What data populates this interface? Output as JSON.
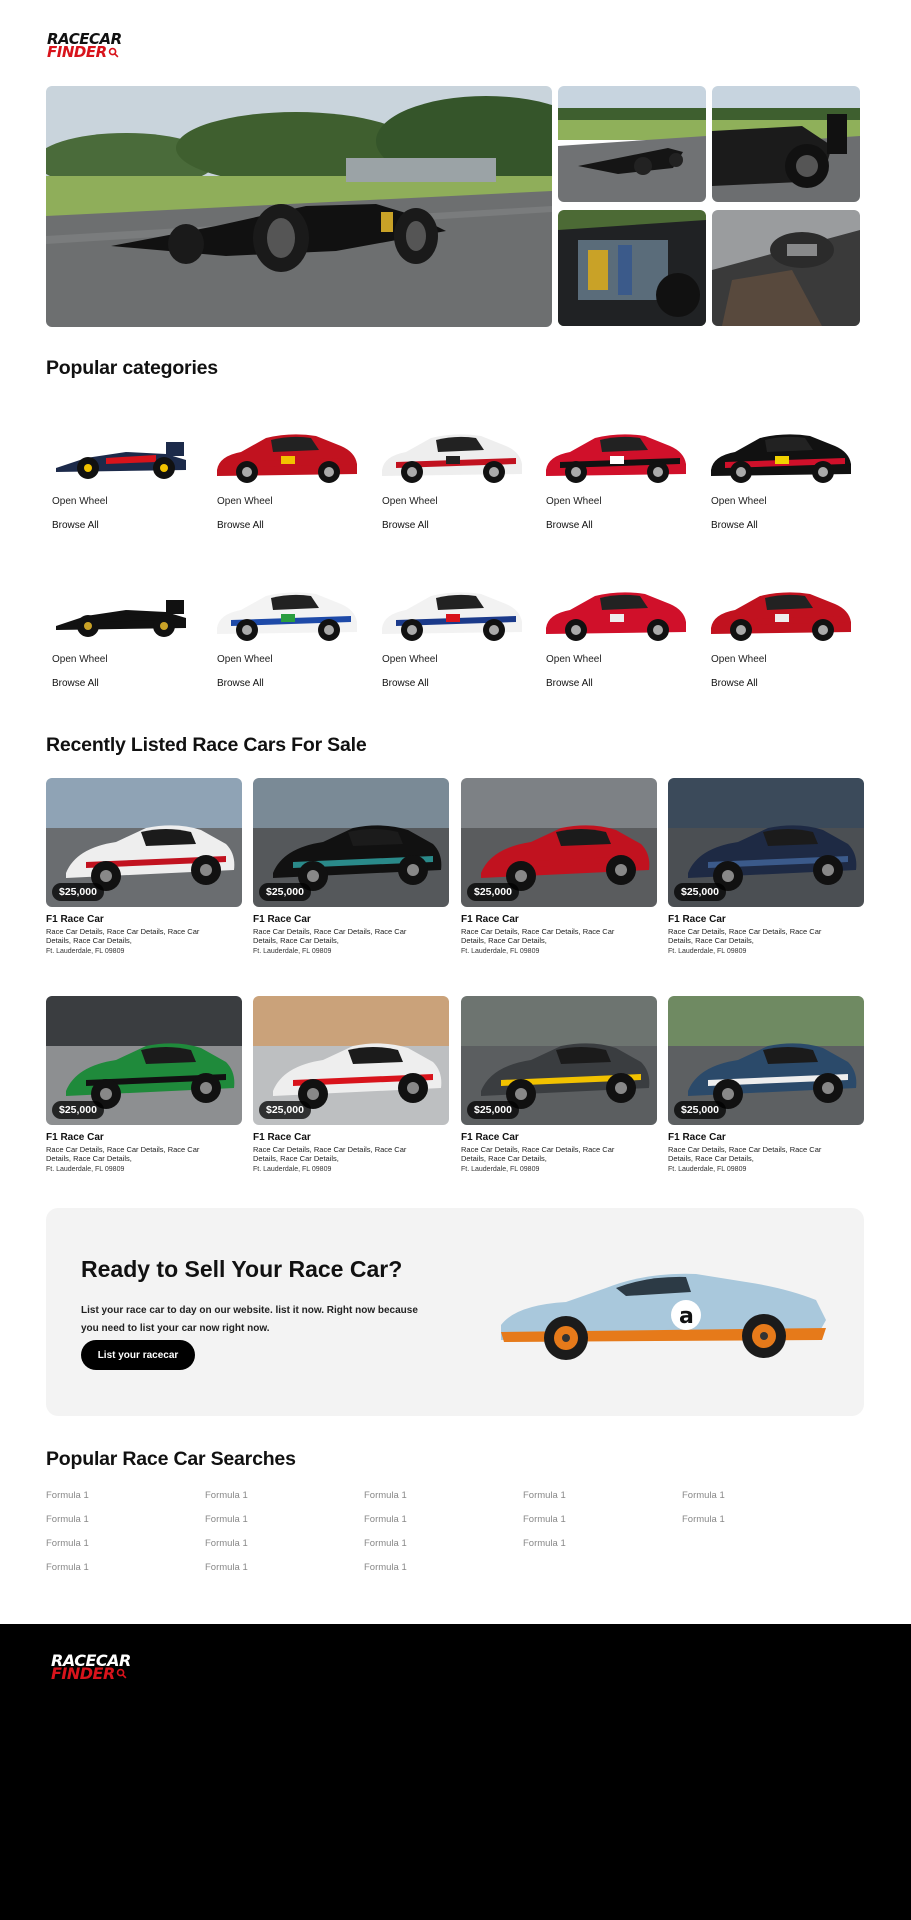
{
  "brand": {
    "line1": "RACECAR",
    "line2": "FINDER",
    "accent": "#d8131b"
  },
  "sections": {
    "categories_title": "Popular categories",
    "listings_title": "Recently Listed Race Cars For Sale",
    "searches_title": "Popular Race Car Searches"
  },
  "categories": [
    {
      "name": "Open Wheel",
      "browse": "Browse All",
      "icon": "f1-car-redbull"
    },
    {
      "name": "Open Wheel",
      "browse": "Browse All",
      "icon": "prototype-ferrari"
    },
    {
      "name": "Open Wheel",
      "browse": "Browse All",
      "icon": "gt-porsche-91"
    },
    {
      "name": "Open Wheel",
      "browse": "Browse All",
      "icon": "touring-car-red"
    },
    {
      "name": "Open Wheel",
      "browse": "Browse All",
      "icon": "nascar-24"
    },
    {
      "name": "Open Wheel",
      "browse": "Browse All",
      "icon": "vintage-f1-black"
    },
    {
      "name": "Open Wheel",
      "browse": "Browse All",
      "icon": "rally-car-blue"
    },
    {
      "name": "Open Wheel",
      "browse": "Browse All",
      "icon": "gt-worthouse"
    },
    {
      "name": "Open Wheel",
      "browse": "Browse All",
      "icon": "vintage-roadster-red"
    },
    {
      "name": "Open Wheel",
      "browse": "Browse All",
      "icon": "miata-roadster-red"
    }
  ],
  "listings": [
    {
      "price": "$25,000",
      "title": "F1 Race Car",
      "desc": "Race Car Details, Race Car Details, Race Car Details, Race Car Details,",
      "location": "Ft. Lauderdale, FL 09809"
    },
    {
      "price": "$25,000",
      "title": "F1 Race Car",
      "desc": "Race Car Details, Race Car Details, Race Car Details, Race Car Details,",
      "location": "Ft. Lauderdale, FL 09809"
    },
    {
      "price": "$25,000",
      "title": "F1 Race Car",
      "desc": "Race Car Details, Race Car Details, Race Car Details, Race Car Details,",
      "location": "Ft. Lauderdale, FL 09809"
    },
    {
      "price": "$25,000",
      "title": "F1 Race Car",
      "desc": "Race Car Details, Race Car Details, Race Car Details, Race Car Details,",
      "location": "Ft. Lauderdale, FL 09809"
    },
    {
      "price": "$25,000",
      "title": "F1 Race Car",
      "desc": "Race Car Details, Race Car Details, Race Car Details, Race Car Details,",
      "location": "Ft. Lauderdale, FL 09809"
    },
    {
      "price": "$25,000",
      "title": "F1 Race Car",
      "desc": "Race Car Details, Race Car Details, Race Car Details, Race Car Details,",
      "location": "Ft. Lauderdale, FL 09809"
    },
    {
      "price": "$25,000",
      "title": "F1 Race Car",
      "desc": "Race Car Details, Race Car Details, Race Car Details, Race Car Details,",
      "location": "Ft. Lauderdale, FL 09809"
    },
    {
      "price": "$25,000",
      "title": "F1 Race Car",
      "desc": "Race Car Details, Race Car Details, Race Car Details, Race Car Details,",
      "location": "Ft. Lauderdale, FL 09809"
    }
  ],
  "sell": {
    "title": "Ready to Sell Your Race Car?",
    "text": "List your race car to day on our website. list it now. Right now because you need to list your car now right now.",
    "button": "List your racecar"
  },
  "searches": {
    "col1": [
      "Formula 1",
      "Formula 1",
      "Formula 1",
      "Formula 1"
    ],
    "col2": [
      "Formula 1",
      "Formula 1",
      "Formula 1",
      "Formula 1"
    ],
    "col3": [
      "Formula 1",
      "Formula 1",
      "Formula 1",
      "Formula 1"
    ],
    "col4": [
      "Formula 1",
      "Formula 1",
      "Formula 1"
    ],
    "col5": [
      "Formula 1",
      "Formula 1"
    ]
  }
}
